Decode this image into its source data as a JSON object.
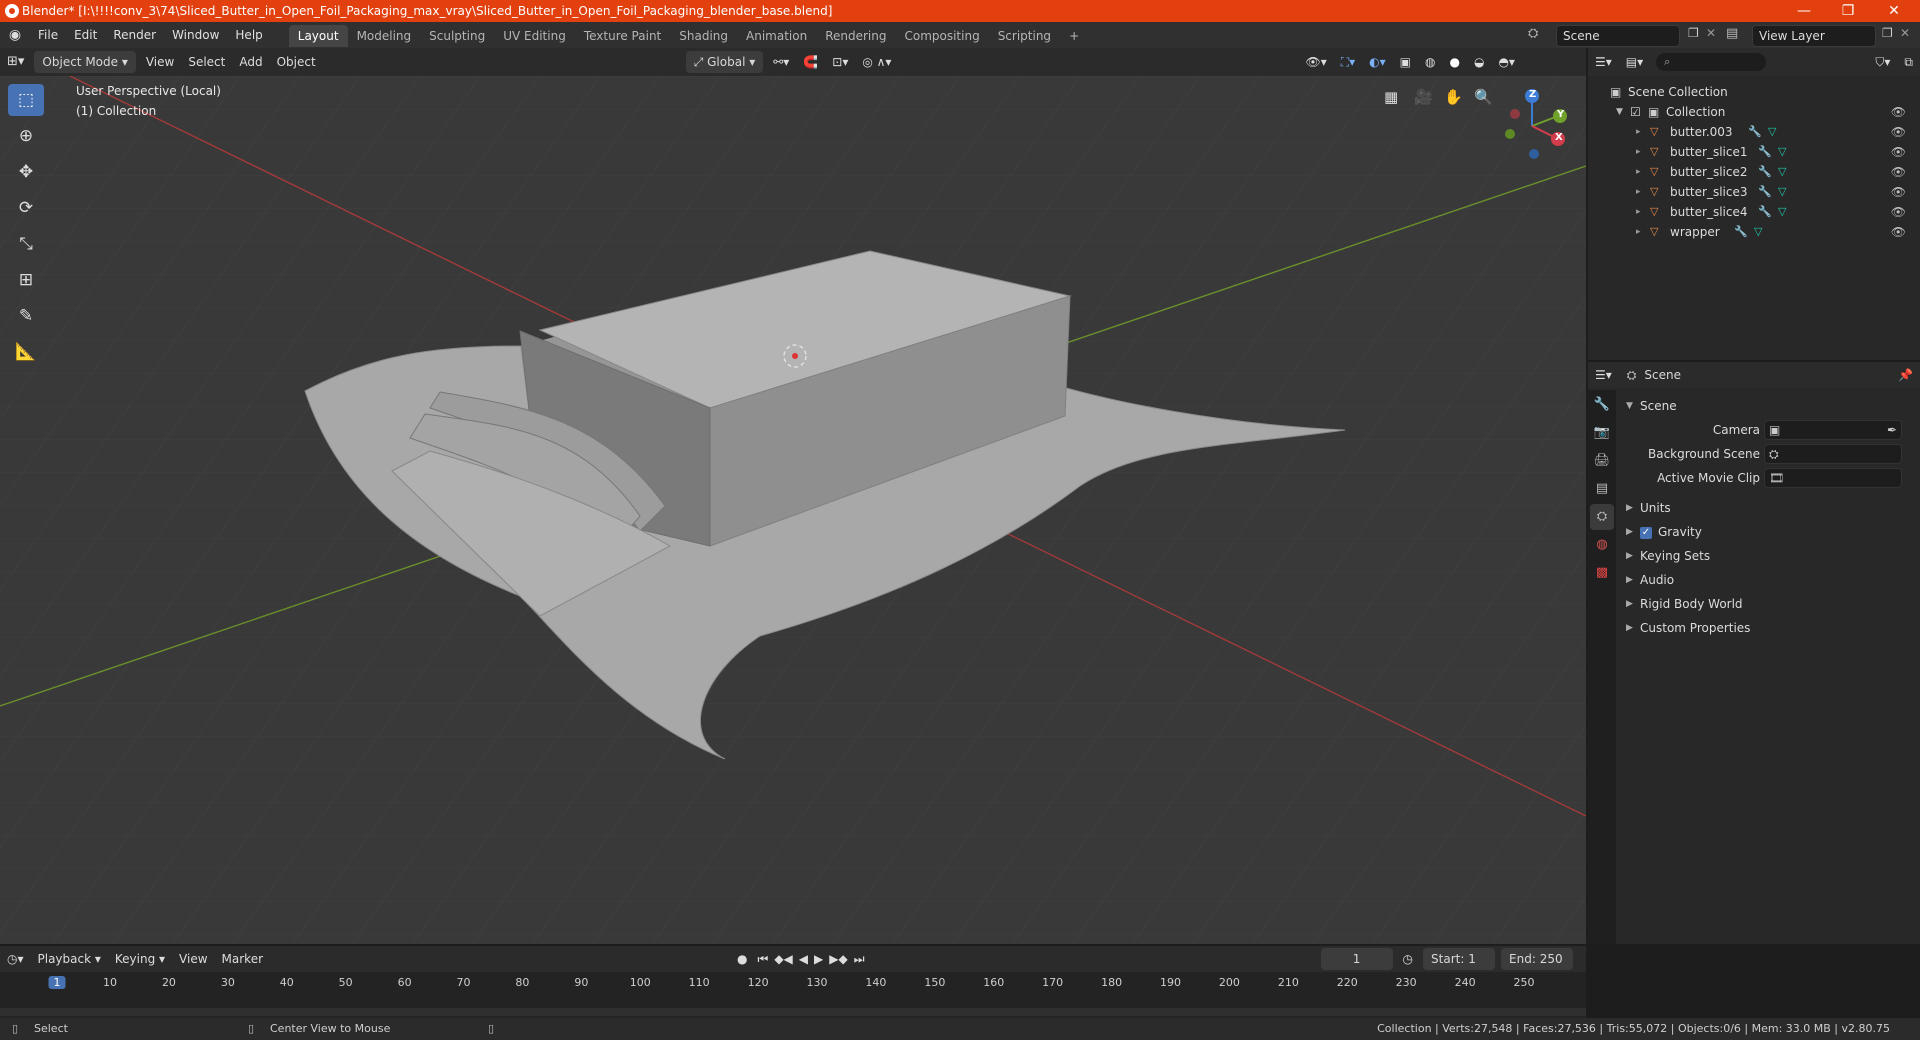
{
  "window": {
    "title": "Blender* [I:\\!!!!conv_3\\74\\Sliced_Butter_in_Open_Foil_Packaging_max_vray\\Sliced_Butter_in_Open_Foil_Packaging_blender_base.blend]",
    "minimize": "—",
    "restore": "❐",
    "close": "✕"
  },
  "menu": [
    "File",
    "Edit",
    "Render",
    "Window",
    "Help"
  ],
  "workspaces": [
    "Layout",
    "Modeling",
    "Sculpting",
    "UV Editing",
    "Texture Paint",
    "Shading",
    "Animation",
    "Rendering",
    "Compositing",
    "Scripting"
  ],
  "add_workspace": "+",
  "scene_name": "Scene",
  "view_layer": "View Layer",
  "vp_header": {
    "mode": "Object Mode",
    "view": "View",
    "select": "Select",
    "add": "Add",
    "object": "Object",
    "orientation": "Global"
  },
  "viewport": {
    "perspective": "User Perspective (Local)",
    "collection": "(1) Collection"
  },
  "gizmo": {
    "x": "X",
    "y": "Y",
    "z": "Z"
  },
  "outliner": {
    "root": "Scene Collection",
    "collection": "Collection",
    "items": [
      "butter.003",
      "butter_slice1",
      "butter_slice2",
      "butter_slice3",
      "butter_slice4",
      "wrapper"
    ]
  },
  "properties": {
    "header": "Scene",
    "section": "Scene",
    "camera_label": "Camera",
    "bg_scene_label": "Background Scene",
    "movie_clip_label": "Active Movie Clip",
    "panels": [
      "Units",
      "Gravity",
      "Keying Sets",
      "Audio",
      "Rigid Body World",
      "Custom Properties"
    ],
    "gravity_checked": true
  },
  "timeline": {
    "playback": "Playback",
    "keying": "Keying",
    "view": "View",
    "marker": "Marker",
    "current_frame": "1",
    "start_label": "Start:",
    "start": "1",
    "end_label": "End:",
    "end": "250",
    "ticks": [
      "1",
      "10",
      "20",
      "30",
      "40",
      "50",
      "60",
      "70",
      "80",
      "90",
      "100",
      "110",
      "120",
      "130",
      "140",
      "150",
      "160",
      "170",
      "180",
      "190",
      "200",
      "210",
      "220",
      "230",
      "240",
      "250"
    ]
  },
  "status": {
    "select": "Select",
    "center": "Center View to Mouse",
    "stats": "Collection | Verts:27,548 | Faces:27,536 | Tris:55,072 | Objects:0/6 | Mem: 33.0 MB | v2.80.75"
  }
}
